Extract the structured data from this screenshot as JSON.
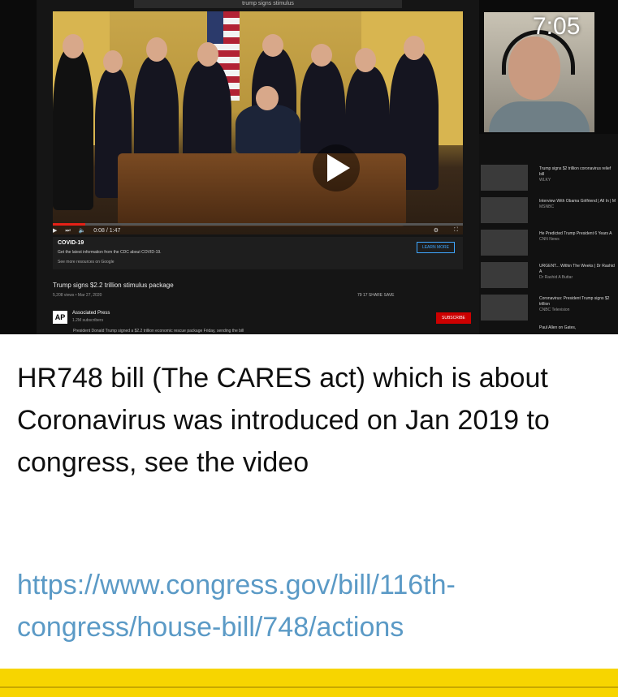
{
  "video": {
    "timestamp": "7:05",
    "inner_search": "trump signs stimulus",
    "controls_time": "0:08 / 1:47",
    "panel_title": "COVID-19",
    "panel_sub": "Get the latest information from the CDC about COVID-19.",
    "panel_link": "See more resources on Google",
    "learn_more": "LEARN MORE",
    "title": "Trump signs $2.2 trillion stimulus package",
    "meta": "5,208 views • Mar 27, 2020",
    "actions": "79    17    SHARE    SAVE",
    "channel_logo": "AP",
    "channel_name": "Associated Press",
    "subscribers": "1.2M subscribers",
    "subscribe": "SUBSCRIBE",
    "description": "President Donald Trump signed a $2.2 trillion economic rescue package Friday, sending the bill",
    "side_items": [
      {
        "title": "Trump signs $2 trillion coronavirus relief bill",
        "meta": "WLKY"
      },
      {
        "title": "Interview With Obama Girlfriend | All In | M",
        "meta": "MSNBC"
      },
      {
        "title": "He Predicted Trump President 6 Years A",
        "meta": "CNN News"
      },
      {
        "title": "URGENT... Within The Weeks | Dr Rashid A",
        "meta": "Dr Rashid A Buttar"
      },
      {
        "title": "Coronavirus: President Trump signs $2 trillion",
        "meta": "CNBC Television"
      },
      {
        "title": "Paul Allen on Gates,",
        "meta": ""
      }
    ]
  },
  "caption": "HR748 bill (The CARES act) which is about Coronavirus was introduced on Jan 2019 to congress, see the video",
  "link": "https://www.congress.gov/bill/116th-congress/house-bill/748/actions",
  "colors": {
    "link": "#5b9ac6",
    "bottom_bar": "#f7d500",
    "accent_red": "#e62117"
  }
}
